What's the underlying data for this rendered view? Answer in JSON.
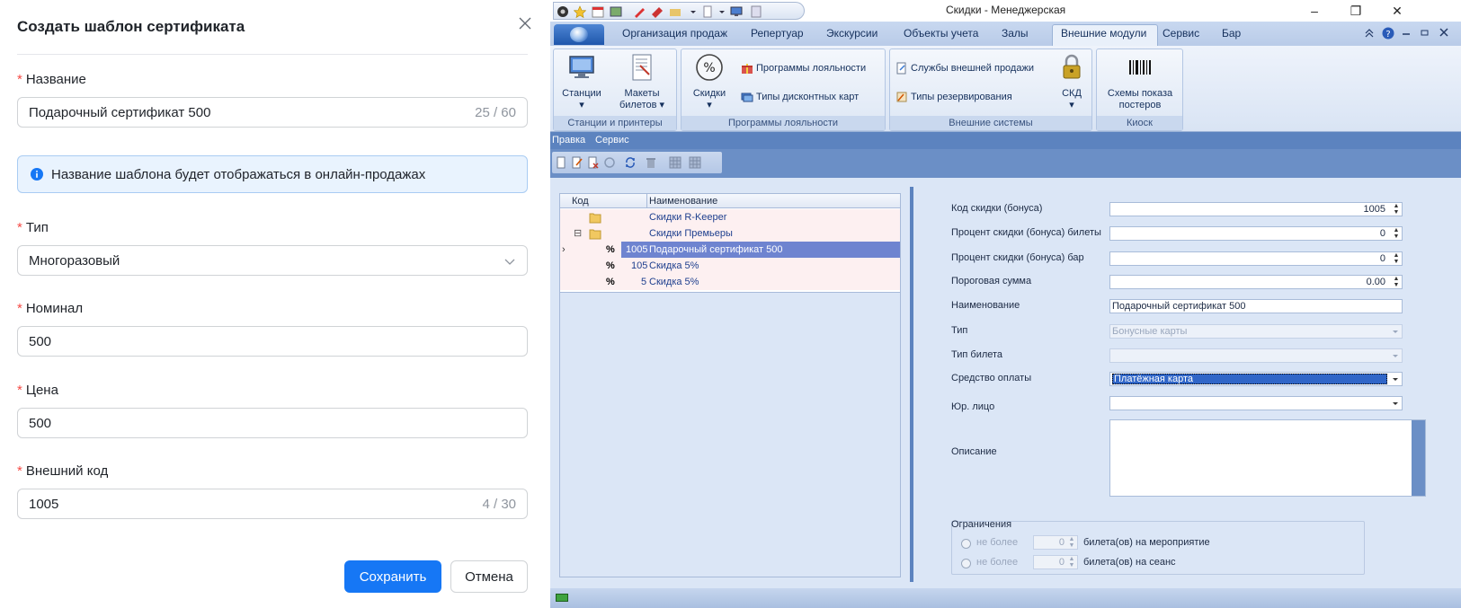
{
  "dialog": {
    "title": "Создать шаблон сертификата",
    "name_label": "Название",
    "name_value": "Подарочный сертификат 500",
    "name_count": "25 / 60",
    "info_text": "Название шаблона будет отображаться в онлайн-продажах",
    "type_label": "Тип",
    "type_value": "Многоразовый",
    "nominal_label": "Номинал",
    "nominal_value": "500",
    "price_label": "Цена",
    "price_value": "500",
    "extcode_label": "Внешний код",
    "extcode_value": "1005",
    "extcode_count": "4 / 30",
    "required_mark": "*",
    "save_label": "Сохранить",
    "cancel_label": "Отмена",
    "accent_color": "#1677f5"
  },
  "app": {
    "window_title": "Скидки - Менеджерская",
    "window_buttons": {
      "minimize": "–",
      "maximize": "❐",
      "close": "✕"
    },
    "ribbon_tabs": [
      "Организация продаж",
      "Репертуар",
      "Экскурсии",
      "Объекты учета",
      "Залы",
      "Внешние модули",
      "Сервис",
      "Бар"
    ],
    "active_tab": "Внешние модули",
    "ribbon": {
      "stations": "Станции",
      "ticket_layouts_1": "Макеты",
      "ticket_layouts_2": "билетов",
      "group_stations": "Станции и принтеры",
      "discounts": "Скидки",
      "loyalty_programs": "Программы лояльности",
      "discount_card_types": "Типы дисконтных карт",
      "group_loyalty": "Программы лояльности",
      "external_sales": "Службы внешней продажи",
      "reservation_types": "Типы резервирования",
      "skd": "СКД",
      "group_external": "Внешние системы",
      "poster_schemes_1": "Схемы показа",
      "poster_schemes_2": "постеров",
      "group_kiosk": "Киоск"
    },
    "menu": [
      "Правка",
      "Сервис"
    ],
    "grid": {
      "col_code": "Код",
      "col_name": "Наименование",
      "rows": [
        {
          "text": "Скидки R-Keeper"
        },
        {
          "text": "Скидки Премьеры"
        },
        {
          "code": "1005",
          "text": "Подарочный сертификат 500"
        },
        {
          "code": "105",
          "text": "Скидка 5%"
        },
        {
          "code": "5",
          "text": "Скидка 5%"
        }
      ],
      "percent_glyph": "%",
      "expand_glyph": "⊟",
      "row_indicator": "›"
    },
    "form": {
      "discount_code_label": "Код скидки (бонуса)",
      "discount_code_value": "1005",
      "ticket_percent_label": "Процент скидки (бонуса) билеты",
      "ticket_percent_value": "0",
      "bar_percent_label": "Процент скидки (бонуса) бар",
      "bar_percent_value": "0",
      "threshold_label": "Пороговая сумма",
      "threshold_value": "0.00",
      "name_label": "Наименование",
      "name_value": "Подарочный сертификат 500",
      "type_label": "Тип",
      "type_value": "Бонусные карты",
      "ticket_type_label": "Тип билета",
      "payment_label": "Средство оплаты",
      "payment_value": "Платёжная карта",
      "legal_entity_label": "Юр. лицо",
      "description_label": "Описание",
      "limits_title": "Ограничения",
      "limit1_label": "не более",
      "limit1_value": "0",
      "limit1_suffix": "билета(ов) на мероприятие",
      "limit2_label": "не более",
      "limit2_value": "0",
      "limit2_suffix": "билета(ов) на сеанс"
    }
  }
}
